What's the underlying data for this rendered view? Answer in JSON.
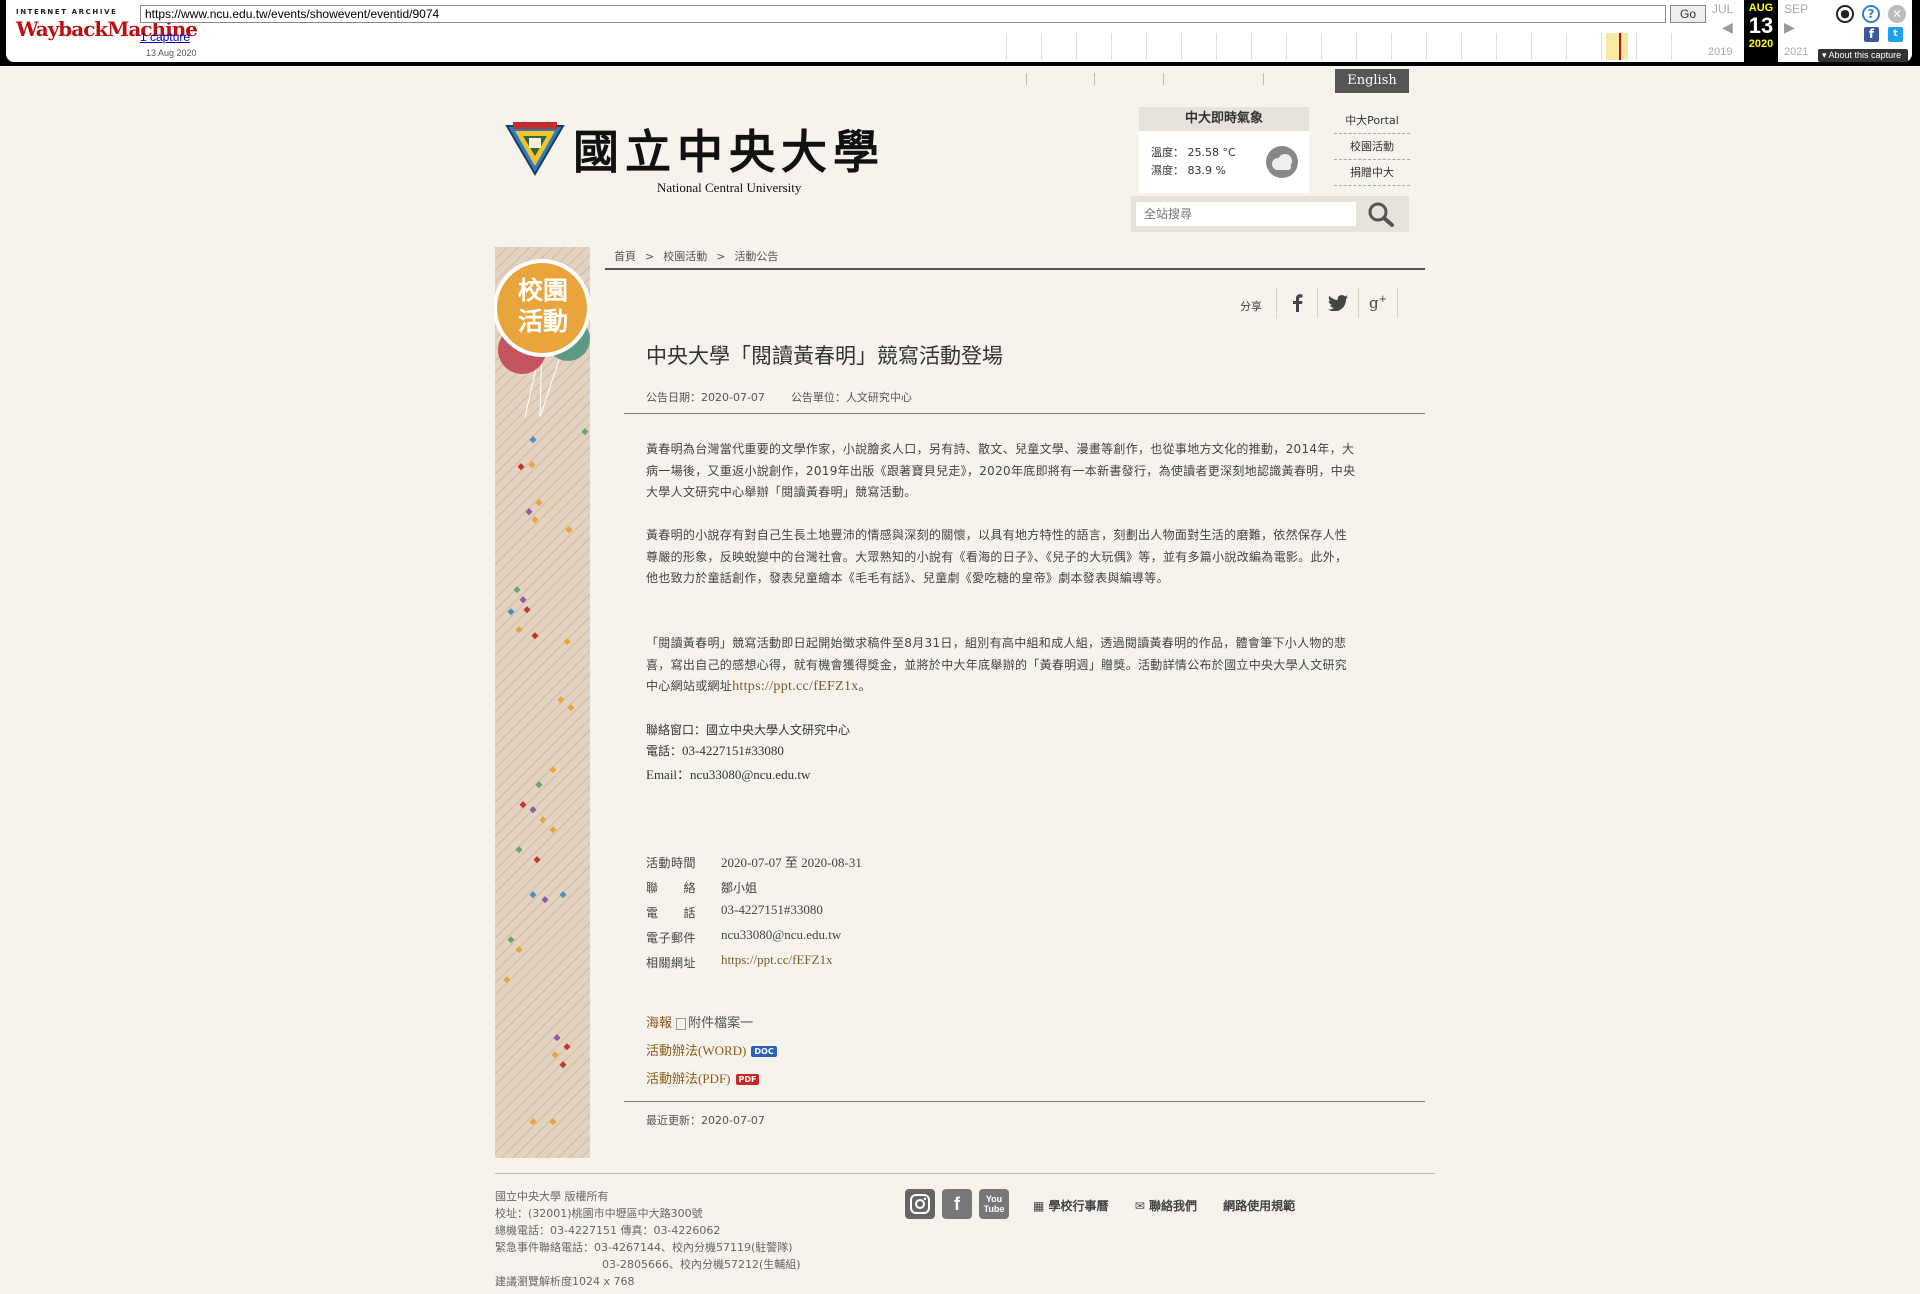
{
  "wayback": {
    "brand_top": "INTERNET ARCHIVE",
    "brand_logo": "WaybackMachine",
    "url": "https://www.ncu.edu.tw/events/showevent/eventid/9074",
    "go_label": "Go",
    "captures_link": "1 capture",
    "capture_date": "13 Aug 2020",
    "months": [
      "JUL",
      "AUG",
      "SEP"
    ],
    "current_day": "13",
    "years": [
      "2019",
      "2020",
      "2021"
    ],
    "about_label": "About this capture"
  },
  "header": {
    "english_link": "English",
    "logo_cn": "國立中央大學",
    "logo_en": "National Central University",
    "weather": {
      "title": "中大即時氣象",
      "temp_label": "溫度：",
      "temp_value": "25.58 °C",
      "humidity_label": "濕度：",
      "humidity_value": "83.9 %"
    },
    "quick_links": [
      "中大Portal",
      "校園活動",
      "捐贈中大"
    ],
    "search_placeholder": "全站搜尋"
  },
  "banner": {
    "line1": "校園",
    "line2": "活動"
  },
  "breadcrumb": [
    "首頁",
    "校園活動",
    "活動公告"
  ],
  "breadcrumb_sep": ">",
  "share": {
    "label": "分享",
    "icons": [
      "facebook-icon",
      "twitter-icon",
      "google-plus-icon"
    ]
  },
  "article": {
    "title": "中央大學「閱讀黃春明」競寫活動登場",
    "date_label": "公告日期：2020-07-07",
    "unit_label": "公告單位：人文研究中心",
    "paragraphs": [
      "黃春明為台灣當代重要的文學作家，小說膾炙人口，另有詩、散文、兒童文學、漫畫等創作，也從事地方文化的推動，2014年，大病一場後，又重返小說創作，2019年出版《跟著寶貝兒走》，2020年底即將有一本新書發行，為使讀者更深刻地認識黃春明，中央大學人文研究中心舉辦「閱讀黃春明」競寫活動。",
      "黃春明的小說存有對自己生長土地豐沛的情感與深刻的關懷，以具有地方特性的語言，刻劃出人物面對生活的磨難，依然保存人性尊嚴的形象，反映蛻變中的台灣社會。大眾熟知的小說有《看海的日子》、《兒子的大玩偶》等，並有多篇小說改編為電影。此外，他也致力於童話創作，發表兒童繪本《毛毛有話》、兒童劇《愛吃糖的皇帝》劇本發表與編導等。",
      "「閱讀黃春明」競寫活動即日起開始徵求稿件至8月31日，組別有高中組和成人組，透過閱讀黃春明的作品，體會筆下小人物的悲喜，寫出自己的感想心得，就有機會獲得獎金，並將於中大年底舉辦的「黃春明週」贈獎。活動詳情公布於國立中央大學人文研究中心網站或網址"
    ],
    "paragraph3_link": "https://ppt.cc/fEFZ1x",
    "paragraph3_end": "。",
    "contact_window": "聯絡窗口：國立中央大學人文研究中心",
    "contact_phone_label": "電話：",
    "contact_phone": "03-4227151#33080",
    "contact_email_label": "Email：",
    "contact_email": "ncu33080@ncu.edu.tw"
  },
  "event_info": [
    {
      "label": "活動時間",
      "value": "2020-07-07 至 2020-08-31"
    },
    {
      "label": "聯　　絡",
      "value": "鄒小姐"
    },
    {
      "label": "電　　話",
      "value": "03-4227151#33080"
    },
    {
      "label": "電子郵件",
      "value": "ncu33080@ncu.edu.tw"
    },
    {
      "label": "相關網址",
      "value": "https://ppt.cc/fEFZ1x"
    }
  ],
  "attachments": {
    "poster_label": "海報",
    "poster_alt": "附件檔案一",
    "word_label": "活動辦法(WORD)",
    "word_badge": "DOC",
    "pdf_label": "活動辦法(PDF)",
    "pdf_badge": "PDF"
  },
  "updated": "最近更新：2020-07-07",
  "footer": {
    "lines": [
      "國立中央大學 版權所有",
      "校址：(32001)桃園市中壢區中大路300號",
      "總機電話：03-4227151  傳真：03-4226062",
      "緊急事件聯絡電話：03-4267144、校內分機57119(駐警隊)",
      "03-2805666、校內分機57212(生輔組)",
      "建議瀏覽解析度1024 x 768"
    ],
    "links": [
      "學校行事曆",
      "聯絡我們",
      "網路使用規範"
    ],
    "youtube_label": "You Tube"
  },
  "colors": {
    "background": "#f6f3ec",
    "banner": "#e4d3c0",
    "balloon_orange": "#e9a53b",
    "balloon_red": "#c4545e",
    "balloon_green": "#5c9a86",
    "link_brown": "#7a5a2a"
  }
}
